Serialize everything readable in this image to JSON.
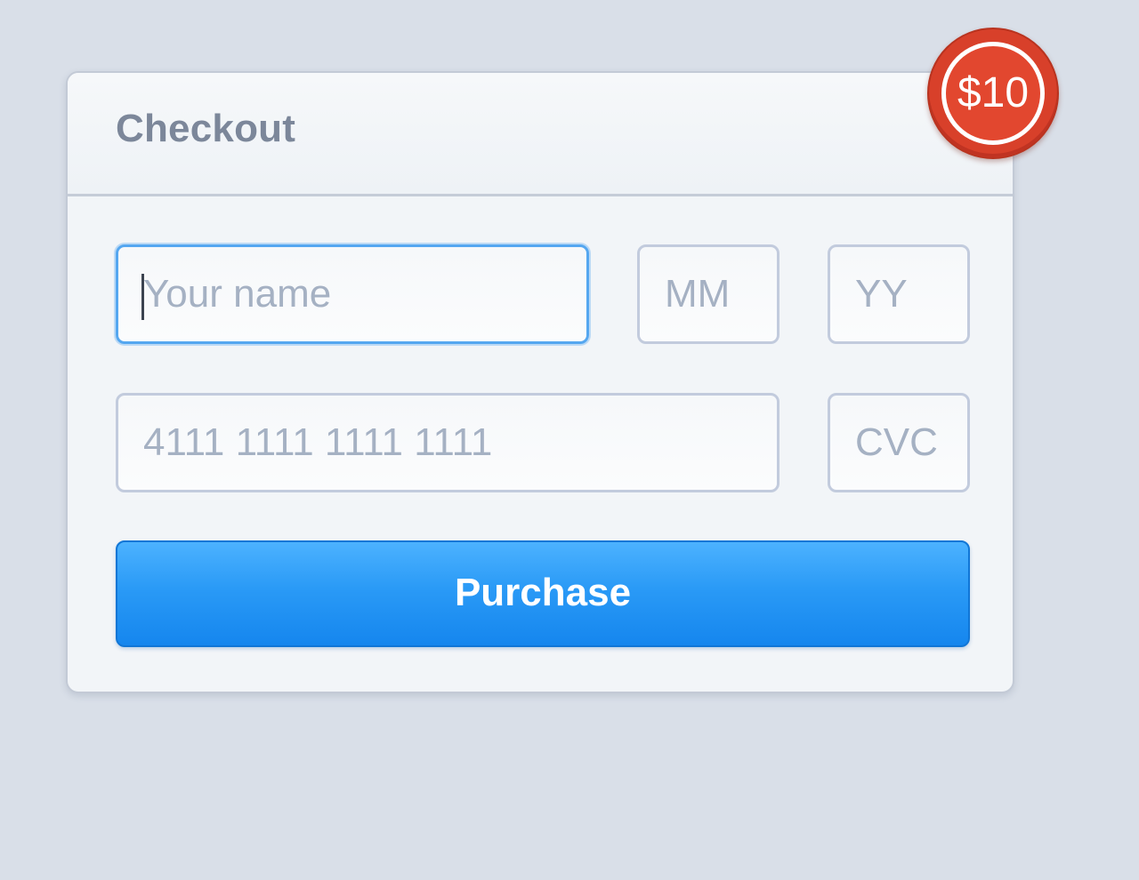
{
  "checkout": {
    "title": "Checkout",
    "price_badge": "$10",
    "fields": {
      "name": {
        "placeholder": "Your name",
        "value": ""
      },
      "month": {
        "placeholder": "MM",
        "value": ""
      },
      "year": {
        "placeholder": "YY",
        "value": ""
      },
      "card_number": {
        "placeholder": "4111 1111 1111 1111",
        "value": ""
      },
      "cvc": {
        "placeholder": "CVC",
        "value": ""
      }
    },
    "purchase_label": "Purchase"
  },
  "colors": {
    "page_background": "#d9dfe8",
    "accent": "#2a9af6",
    "badge": "#d8402a",
    "title_text": "#7c879a",
    "placeholder_text": "#a5b1c3",
    "focus_border": "#55a7f0"
  }
}
